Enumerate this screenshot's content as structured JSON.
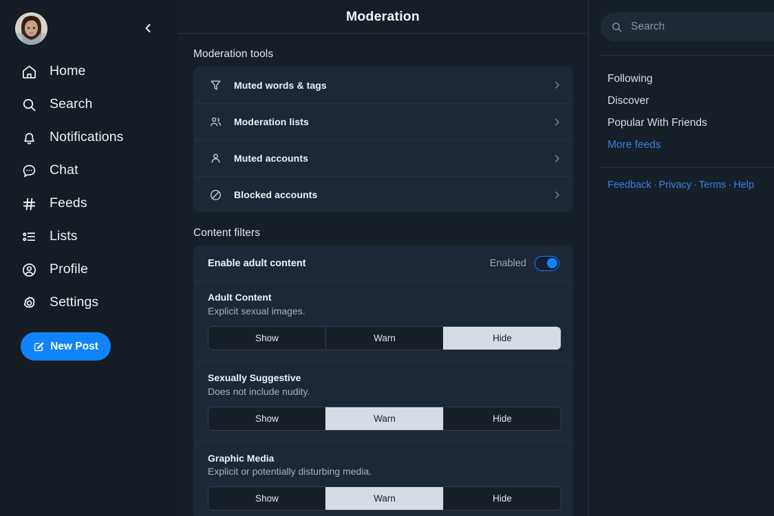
{
  "sidebar": {
    "avatar_alt": "user-avatar",
    "collapse_icon": "chevron-left-icon",
    "items": [
      {
        "icon": "home-icon",
        "label": "Home"
      },
      {
        "icon": "search-icon",
        "label": "Search"
      },
      {
        "icon": "bell-icon",
        "label": "Notifications"
      },
      {
        "icon": "chat-bubble-icon",
        "label": "Chat"
      },
      {
        "icon": "hashtag-icon",
        "label": "Feeds"
      },
      {
        "icon": "list-icon",
        "label": "Lists"
      },
      {
        "icon": "profile-circle-icon",
        "label": "Profile"
      },
      {
        "icon": "gear-icon",
        "label": "Settings"
      }
    ],
    "new_post": {
      "icon": "compose-icon",
      "label": "New Post"
    }
  },
  "main": {
    "title": "Moderation",
    "tools_section_label": "Moderation tools",
    "tools": [
      {
        "icon": "funnel-icon",
        "label": "Muted words & tags",
        "chevron": "chevron-right-icon"
      },
      {
        "icon": "people-icon",
        "label": "Moderation lists",
        "chevron": "chevron-right-icon"
      },
      {
        "icon": "person-icon",
        "label": "Muted accounts",
        "chevron": "chevron-right-icon"
      },
      {
        "icon": "block-circle-icon",
        "label": "Blocked accounts",
        "chevron": "chevron-right-icon"
      }
    ],
    "filters_section_label": "Content filters",
    "adult_toggle": {
      "label": "Enable adult content",
      "state_text": "Enabled",
      "enabled": true
    },
    "filters": [
      {
        "title": "Adult Content",
        "description": "Explicit sexual images.",
        "options": [
          "Show",
          "Warn",
          "Hide"
        ],
        "selected": "Hide"
      },
      {
        "title": "Sexually Suggestive",
        "description": "Does not include nudity.",
        "options": [
          "Show",
          "Warn",
          "Hide"
        ],
        "selected": "Warn"
      },
      {
        "title": "Graphic Media",
        "description": "Explicit or potentially disturbing media.",
        "options": [
          "Show",
          "Warn",
          "Hide"
        ],
        "selected": "Warn"
      }
    ]
  },
  "right": {
    "search": {
      "icon": "search-icon",
      "placeholder": "Search",
      "value": ""
    },
    "feeds": [
      {
        "label": "Following",
        "is_link": false
      },
      {
        "label": "Discover",
        "is_link": false
      },
      {
        "label": "Popular With Friends",
        "is_link": false
      },
      {
        "label": "More feeds",
        "is_link": true
      }
    ],
    "footer": [
      {
        "label": "Feedback"
      },
      {
        "label": "Privacy"
      },
      {
        "label": "Terms"
      },
      {
        "label": "Help"
      }
    ],
    "footer_separator": "·"
  },
  "colors": {
    "page_bg": "#161e27",
    "sidebar_bg": "#151c25",
    "card_bg": "#1d2836",
    "accent": "#1183fe",
    "link": "#3c7fe3",
    "segment_selected_bg": "#d5dce5",
    "border": "#2a3644"
  }
}
